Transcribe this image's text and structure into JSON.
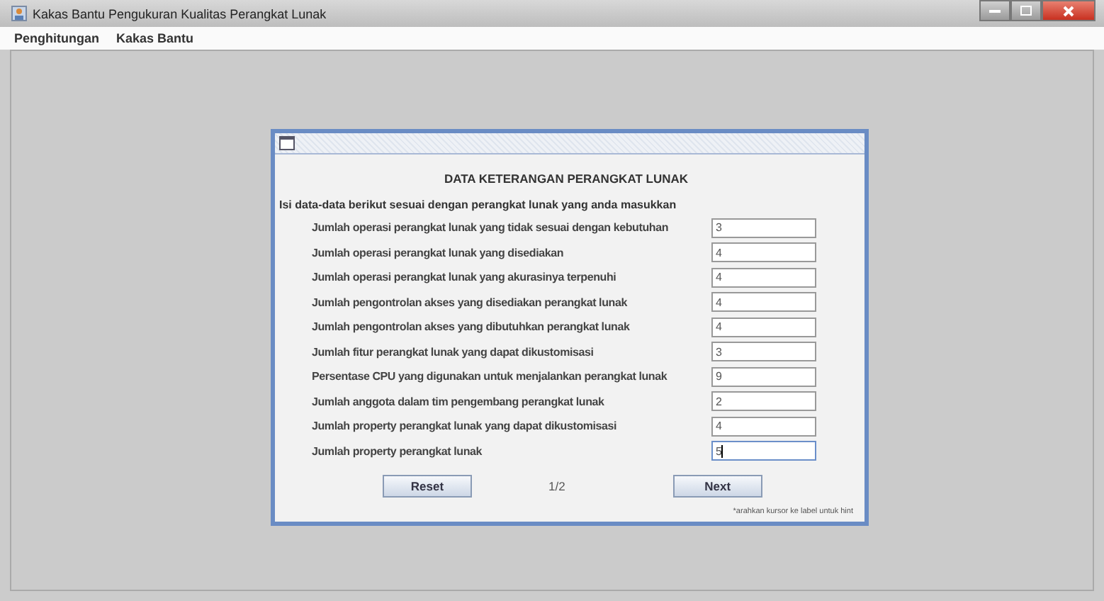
{
  "window": {
    "title": "Kakas Bantu Pengukuran Kualitas Perangkat Lunak"
  },
  "menu": [
    "Penghitungan",
    "Kakas Bantu"
  ],
  "dialog": {
    "heading": "DATA KETERANGAN PERANGKAT LUNAK",
    "instruction": "Isi data-data berikut sesuai dengan perangkat lunak yang anda masukkan",
    "fields": [
      {
        "label": "Jumlah operasi perangkat lunak yang tidak sesuai dengan kebutuhan",
        "value": "3",
        "focused": false
      },
      {
        "label": "Jumlah operasi perangkat lunak yang disediakan",
        "value": "4",
        "focused": false
      },
      {
        "label": "Jumlah operasi perangkat lunak yang akurasinya terpenuhi",
        "value": "4",
        "focused": false
      },
      {
        "label": "Jumlah pengontrolan akses yang disediakan perangkat lunak",
        "value": "4",
        "focused": false
      },
      {
        "label": "Jumlah pengontrolan akses yang dibutuhkan perangkat lunak",
        "value": "4",
        "focused": false
      },
      {
        "label": "Jumlah fitur perangkat lunak yang dapat dikustomisasi",
        "value": "3",
        "focused": false
      },
      {
        "label": "Persentase CPU yang digunakan untuk menjalankan perangkat lunak",
        "value": "9",
        "focused": false
      },
      {
        "label": "Jumlah anggota dalam tim pengembang perangkat lunak",
        "value": "2",
        "focused": false
      },
      {
        "label": "Jumlah property perangkat lunak yang dapat dikustomisasi",
        "value": "4",
        "focused": false
      },
      {
        "label": "Jumlah property perangkat lunak",
        "value": "5",
        "focused": true
      }
    ],
    "reset": "Reset",
    "page": "1/2",
    "next": "Next",
    "hint": "*arahkan kursor ke label untuk hint"
  }
}
